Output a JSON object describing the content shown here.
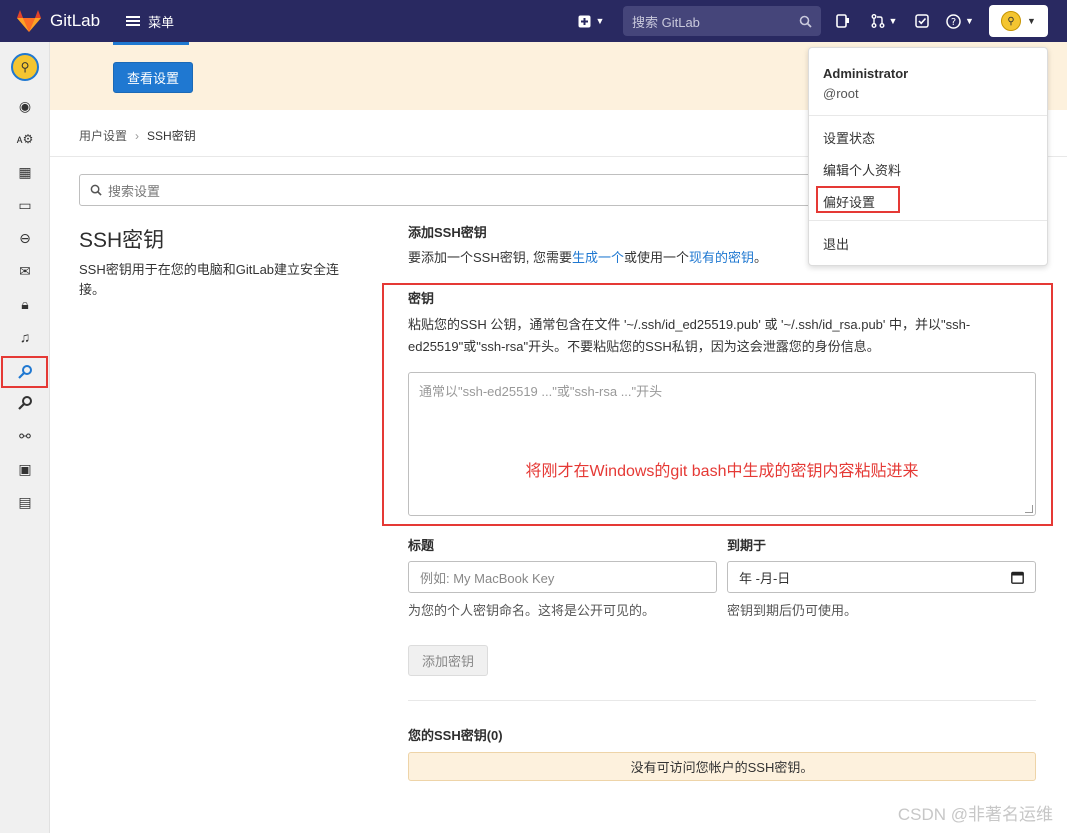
{
  "navbar": {
    "brand": "GitLab",
    "menu_label": "菜单",
    "search_placeholder": "搜索 GitLab"
  },
  "banner": {
    "button_label": "查看设置"
  },
  "breadcrumb": {
    "parent": "用户设置",
    "current": "SSH密钥"
  },
  "settings_search": {
    "placeholder": "搜索设置"
  },
  "page": {
    "title": "SSH密钥",
    "description": "SSH密钥用于在您的电脑和GitLab建立安全连接。"
  },
  "add_section": {
    "title": "添加SSH密钥",
    "text_before": "要添加一个SSH密钥, 您需要",
    "link_generate": "生成一个",
    "text_middle": "或使用一个",
    "link_existing": "现有的密钥",
    "text_after": "。"
  },
  "key_field": {
    "label": "密钥",
    "help": "粘贴您的SSH 公钥，通常包含在文件 '~/.ssh/id_ed25519.pub' 或 '~/.ssh/id_rsa.pub' 中，并以\"ssh-ed25519\"或\"ssh-rsa\"开头。不要粘贴您的SSH私钥，因为这会泄露您的身份信息。",
    "placeholder": "通常以\"ssh-ed25519 ...\"或\"ssh-rsa ...\"开头",
    "annotation": "将刚才在Windows的git bash中生成的密钥内容粘贴进来"
  },
  "title_field": {
    "label": "标题",
    "placeholder": "例如: My MacBook Key",
    "hint": "为您的个人密钥命名。这将是公开可见的。"
  },
  "expiry_field": {
    "label": "到期于",
    "value": "年 -月-日",
    "hint": "密钥到期后仍可使用。"
  },
  "add_button": "添加密钥",
  "your_keys": {
    "title": "您的SSH密钥(0)",
    "empty": "没有可访问您帐户的SSH密钥。"
  },
  "user_dropdown": {
    "name": "Administrator",
    "handle": "@root",
    "items": [
      "设置状态",
      "编辑个人资料",
      "偏好设置",
      "退出"
    ]
  },
  "watermark": "CSDN @非著名运维",
  "colors": {
    "navbar": "#292961",
    "primary": "#1f78d1",
    "annotation_red": "#e53935",
    "banner_bg": "#fdf1dd"
  }
}
